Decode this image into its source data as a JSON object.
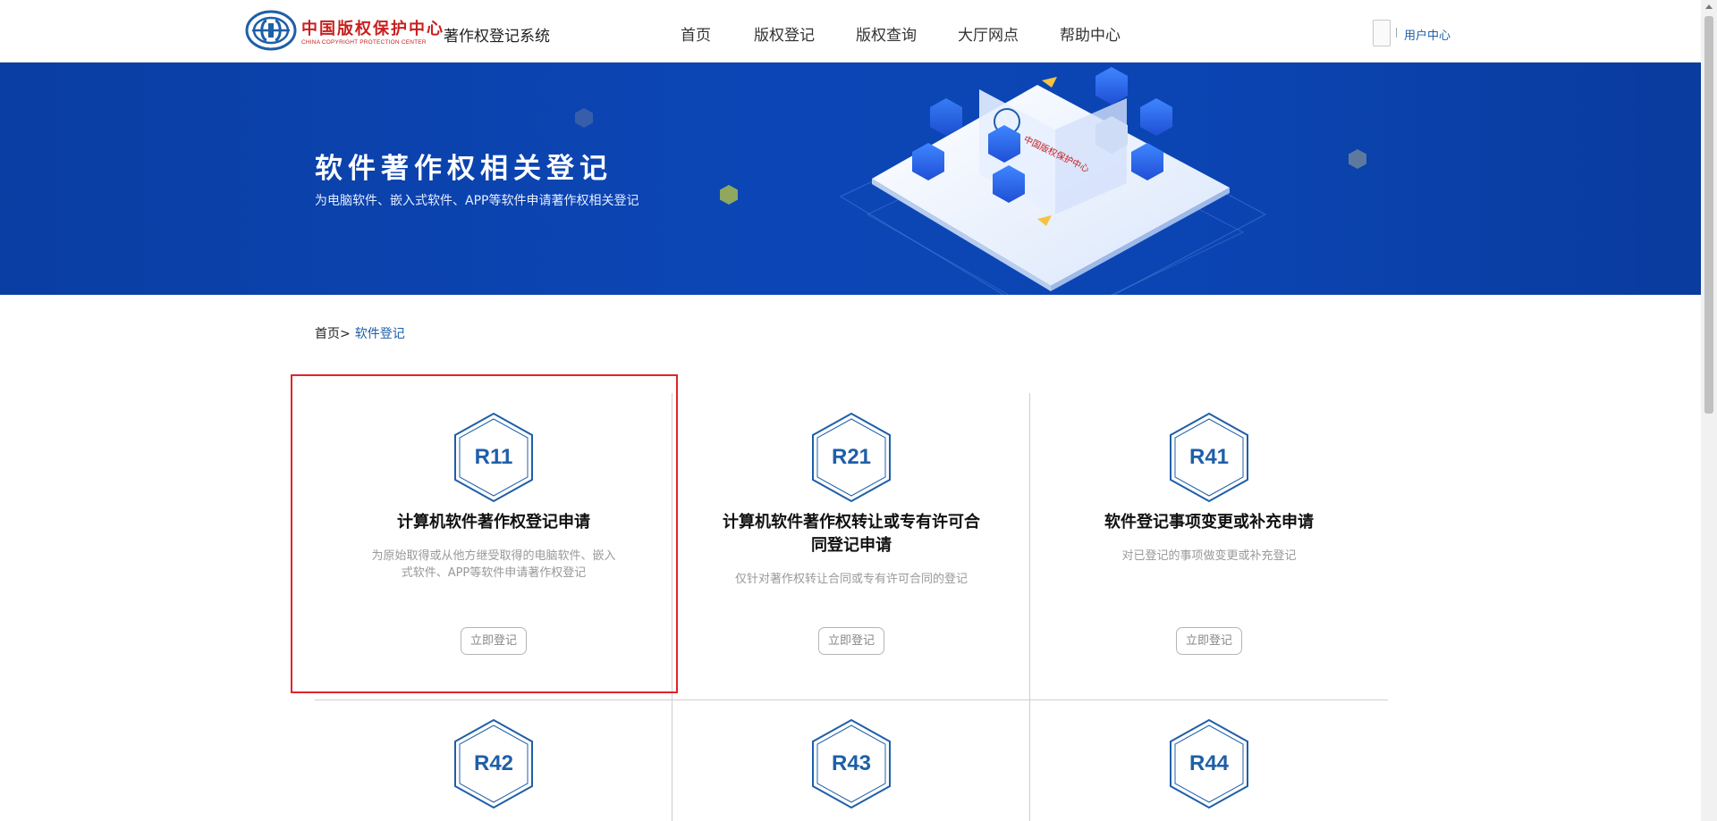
{
  "header": {
    "logo_cn": "中国版权保护中心",
    "logo_en": "CHINA COPYRIGHT PROTECTION CENTER",
    "system_title": "著作权登记系统",
    "nav": [
      {
        "label": "首页"
      },
      {
        "label": "版权登记"
      },
      {
        "label": "版权查询"
      },
      {
        "label": "大厅网点"
      },
      {
        "label": "帮助中心"
      }
    ],
    "user_center": "用户中心"
  },
  "banner": {
    "title": "软件著作权相关登记",
    "subtitle": "为电脑软件、嵌入式软件、APP等软件申请著作权相关登记"
  },
  "breadcrumb": {
    "home": "首页",
    "separator": ">",
    "current": "软件登记"
  },
  "cards": [
    {
      "code": "R11",
      "title": "计算机软件著作权登记申请",
      "desc_line1": "为原始取得或从他方继受取得的电脑软件、嵌入",
      "desc_line2": "式软件、APP等软件申请著作权登记",
      "button": "立即登记"
    },
    {
      "code": "R21",
      "title_line1": "计算机软件著作权转让或专有许可合",
      "title_line2": "同登记申请",
      "desc": "仅针对著作权转让合同或专有许可合同的登记",
      "button": "立即登记"
    },
    {
      "code": "R41",
      "title": "软件登记事项变更或补充申请",
      "desc": "对已登记的事项做变更或补充登记",
      "button": "立即登记"
    },
    {
      "code": "R42"
    },
    {
      "code": "R43"
    },
    {
      "code": "R44"
    }
  ],
  "colors": {
    "brand_blue": "#1e5fa8",
    "banner_blue": "#0c46b6",
    "logo_red": "#c8201f",
    "selection_red": "#e0242b"
  }
}
